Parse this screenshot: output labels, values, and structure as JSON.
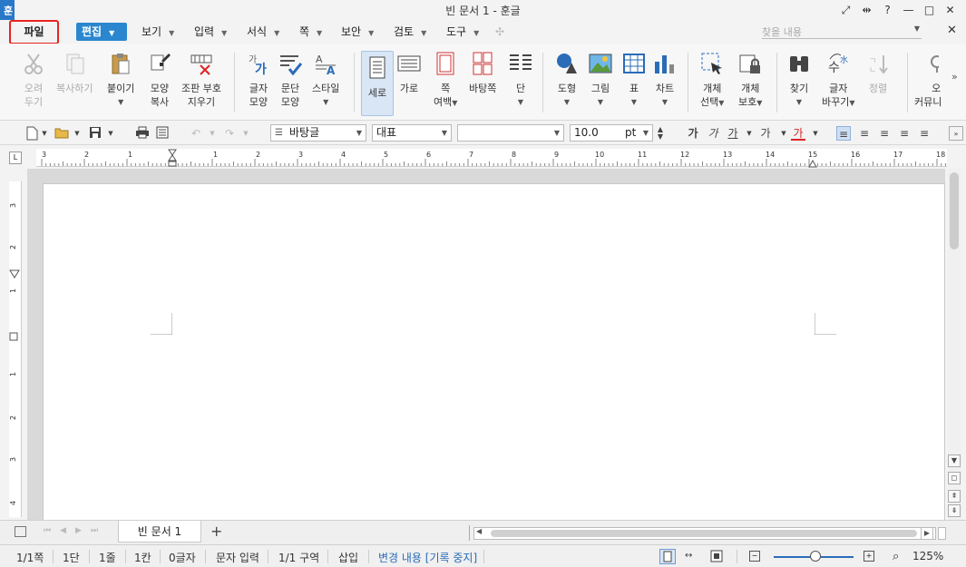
{
  "window": {
    "title": "빈 문서 1 - 훈글",
    "app_badge": "훈",
    "controls": [
      "⤢",
      "⇹",
      "?",
      "—",
      "□",
      "✕"
    ]
  },
  "menu": {
    "file": "파일",
    "edit": "편집",
    "items": [
      "보기",
      "입력",
      "서식",
      "쪽",
      "보안",
      "검토",
      "도구"
    ],
    "find_placeholder": "찾을 내용",
    "close": "✕"
  },
  "ribbon": {
    "cut": {
      "line1": "오려",
      "line2": "두기"
    },
    "copy": {
      "line1": "복사하기"
    },
    "paste": {
      "line1": "붙이기"
    },
    "format_painter": {
      "line1": "모양",
      "line2": "복사"
    },
    "clear_markup": {
      "line1": "조판 부호",
      "line2": "지우기"
    },
    "char_shape": {
      "line1": "글자",
      "line2": "모양"
    },
    "para_shape": {
      "line1": "문단",
      "line2": "모양"
    },
    "style": {
      "line1": "스타일"
    },
    "portrait": {
      "line1": "세로"
    },
    "landscape": {
      "line1": "가로"
    },
    "page_margin": {
      "line1": "쪽",
      "line2": "여백"
    },
    "background": {
      "line1": "바탕쪽"
    },
    "columns": {
      "line1": "단"
    },
    "shapes": {
      "line1": "도형"
    },
    "picture": {
      "line1": "그림"
    },
    "table": {
      "line1": "표"
    },
    "chart": {
      "line1": "차트"
    },
    "object_select": {
      "line1": "개체",
      "line2": "선택"
    },
    "object_protect": {
      "line1": "개체",
      "line2": "보호"
    },
    "find": {
      "line1": "찾기"
    },
    "replace": {
      "line1": "글자",
      "line2": "바꾸기"
    },
    "sort": {
      "line1": "정렬"
    },
    "community": {
      "line1": "오",
      "line2": "커뮤니"
    }
  },
  "format": {
    "style_name": "바탕글",
    "font_lang": "대표",
    "font_name": "",
    "font_size": "10.0",
    "size_unit": "pt"
  },
  "ruler": {
    "h_numbers": [
      "3",
      "2",
      "1",
      "1",
      "1",
      "2",
      "3",
      "4",
      "5",
      "6",
      "7",
      "8",
      "9",
      "10",
      "11",
      "12",
      "13",
      "14",
      "15",
      "16",
      "17",
      "18"
    ],
    "v_numbers": [
      "3",
      "2",
      "1",
      "1",
      "1",
      "2",
      "3",
      "4"
    ]
  },
  "tabs": {
    "doc_tab": "빈 문서 1",
    "add": "+"
  },
  "status": {
    "page": "1/1쪽",
    "column": "1단",
    "line": "1줄",
    "col": "1칸",
    "chars": "0글자",
    "mode": "문자 입력",
    "section": "1/1 구역",
    "insert": "삽입",
    "track": "변경 내용 [기록 중지]",
    "zoom": "125%"
  }
}
